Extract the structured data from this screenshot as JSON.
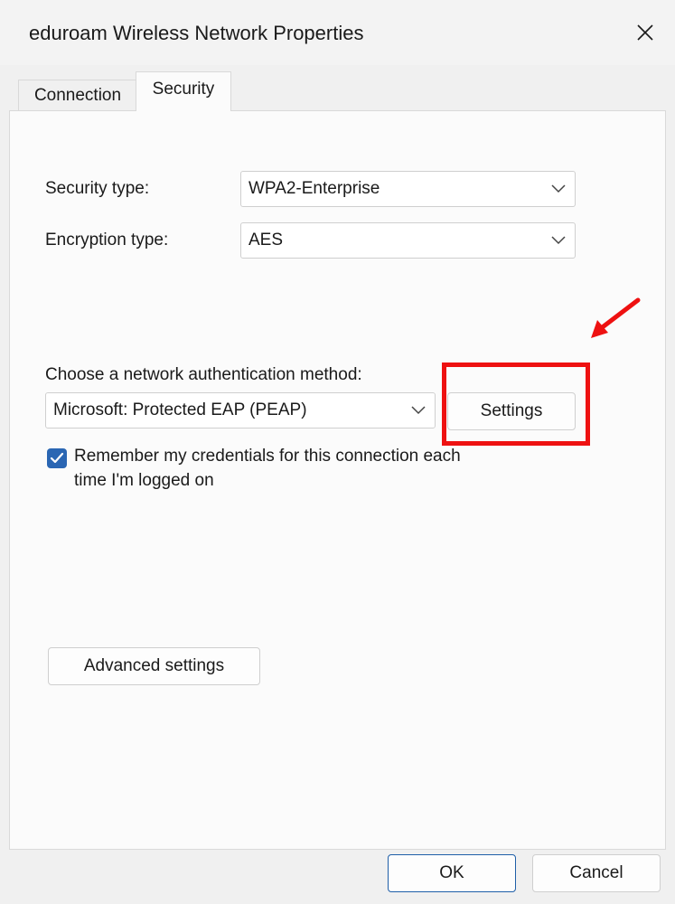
{
  "window": {
    "title": "eduroam Wireless Network Properties"
  },
  "tabs": [
    {
      "label": "Connection",
      "selected": false
    },
    {
      "label": "Security",
      "selected": true
    }
  ],
  "security": {
    "security_type_label": "Security type:",
    "security_type_value": "WPA2-Enterprise",
    "encryption_type_label": "Encryption type:",
    "encryption_type_value": "AES",
    "auth_method_label": "Choose a network authentication method:",
    "auth_method_value": "Microsoft: Protected EAP (PEAP)",
    "settings_label": "Settings",
    "remember_checked": true,
    "remember_line1": "Remember my credentials for this connection each",
    "remember_line2": "time I'm logged on",
    "advanced_label": "Advanced settings"
  },
  "footer": {
    "ok_label": "OK",
    "cancel_label": "Cancel"
  },
  "colors": {
    "accent": "#2a66b3",
    "annotation": "#ee1111"
  },
  "icons": {
    "close": "close-icon",
    "chevron": "chevron-down-icon",
    "check": "checkmark-icon"
  }
}
